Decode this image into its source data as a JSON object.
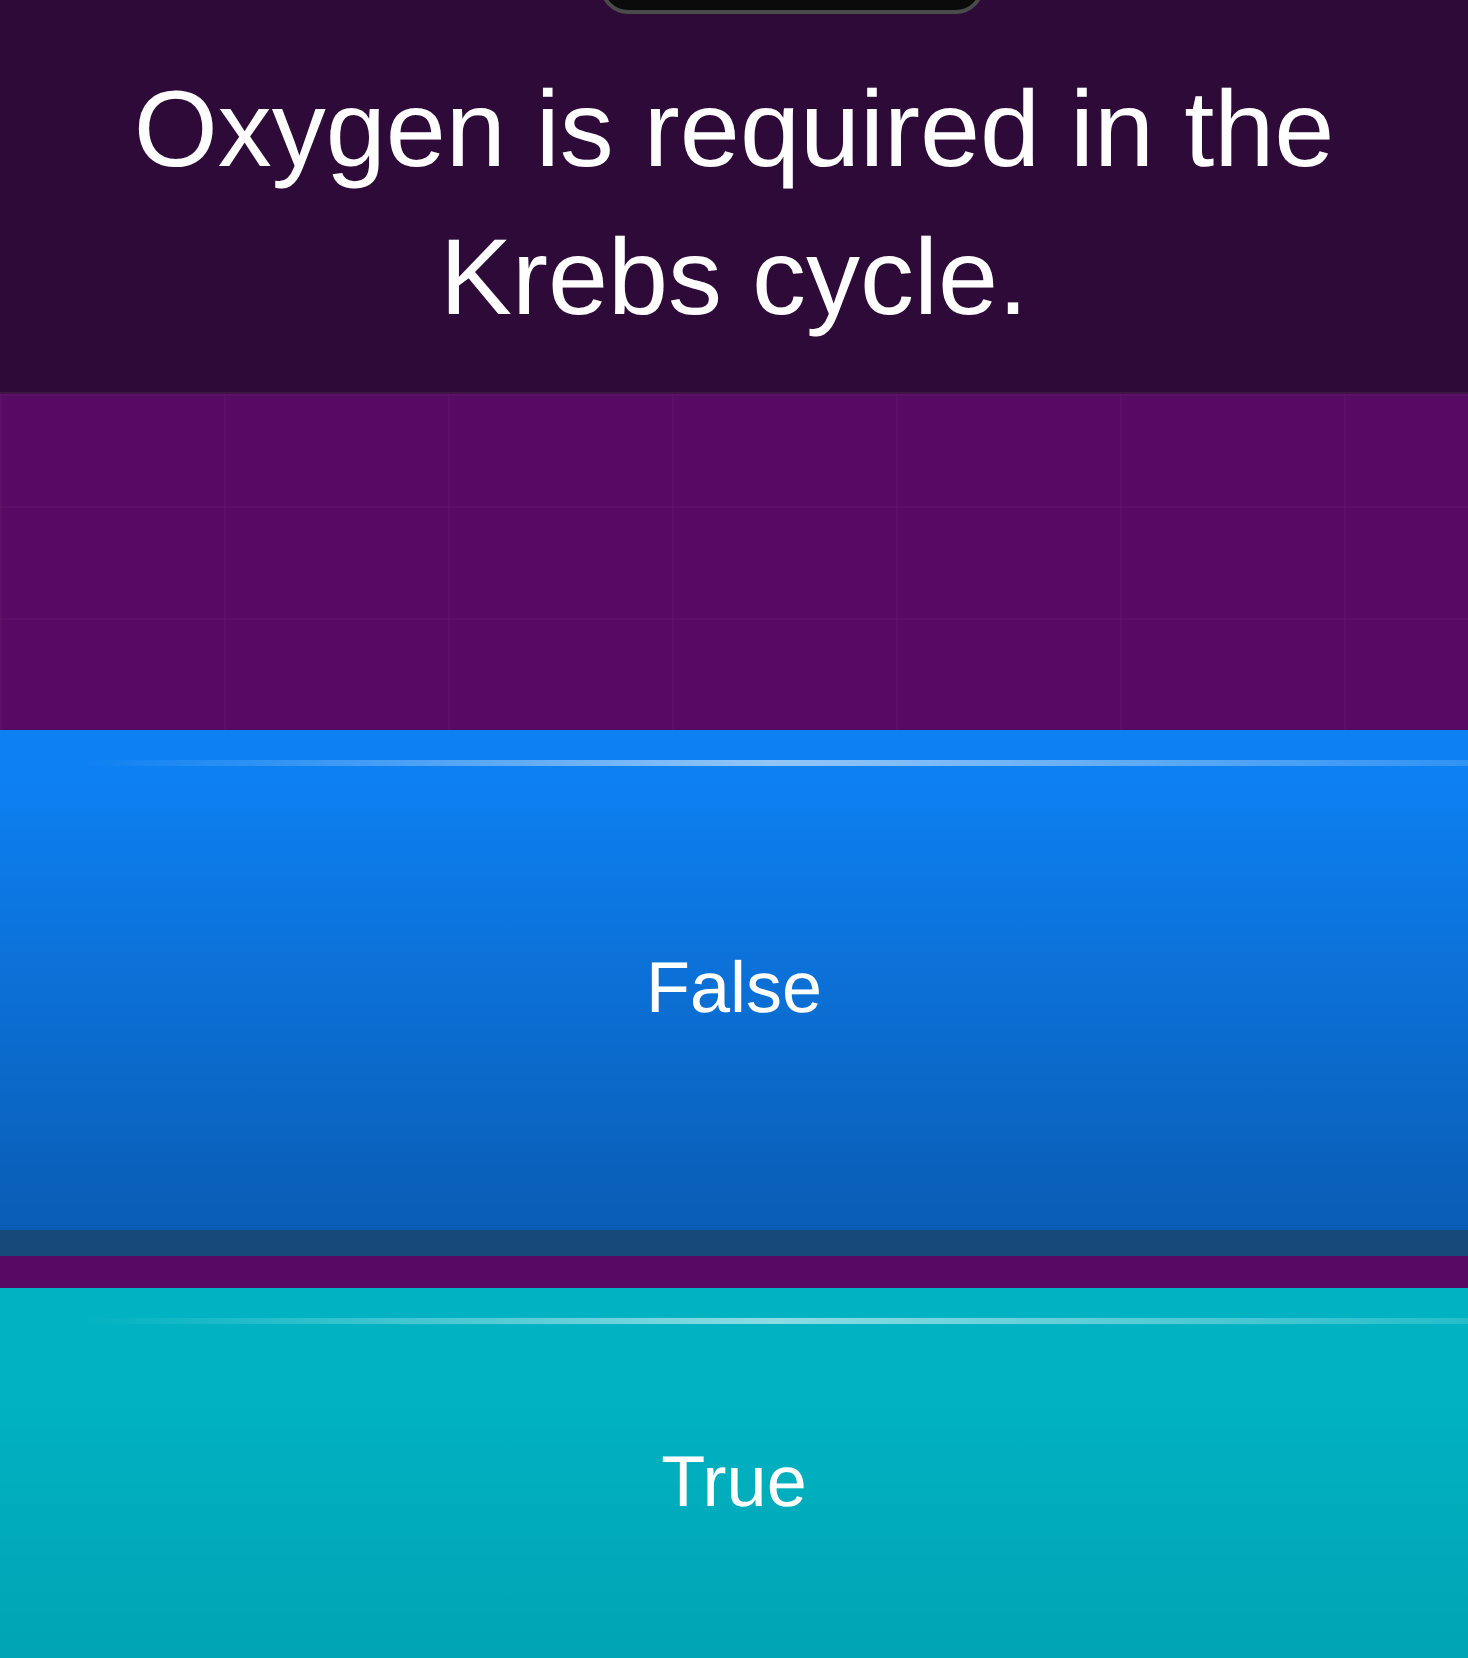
{
  "question": {
    "text": "Oxygen is required in the Krebs cycle."
  },
  "answers": [
    {
      "label": "False",
      "color": "#0d80f2"
    },
    {
      "label": "True",
      "color": "#00b2c2"
    }
  ]
}
